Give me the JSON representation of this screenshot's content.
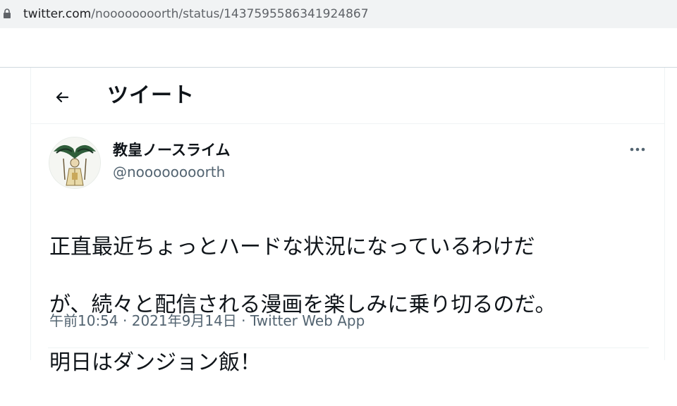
{
  "browser": {
    "url_domain": "twitter.com",
    "url_path": "/noooooooorth/status/1437595586341924867",
    "lock_icon": "lock-icon"
  },
  "header": {
    "back_icon": "arrow-left-icon",
    "title": "ツイート"
  },
  "tweet": {
    "display_name": "教皇ノースライム",
    "handle": "@noooooooorth",
    "more_icon": "more-horizontal-icon",
    "text_lines": [
      "正直最近ちょっとハードな状況になっているわけだ",
      "が、続々と配信される漫画を楽しみに乗り切るのだ。",
      "明日はダンジョン飯！"
    ],
    "time": "午前10:54",
    "separator": "·",
    "date": "2021年9月14日",
    "source": "Twitter Web App"
  },
  "colors": {
    "text_primary": "#0f1419",
    "text_secondary": "#536471",
    "border": "#eff3f4",
    "url_bar": "#f1f3f4"
  }
}
